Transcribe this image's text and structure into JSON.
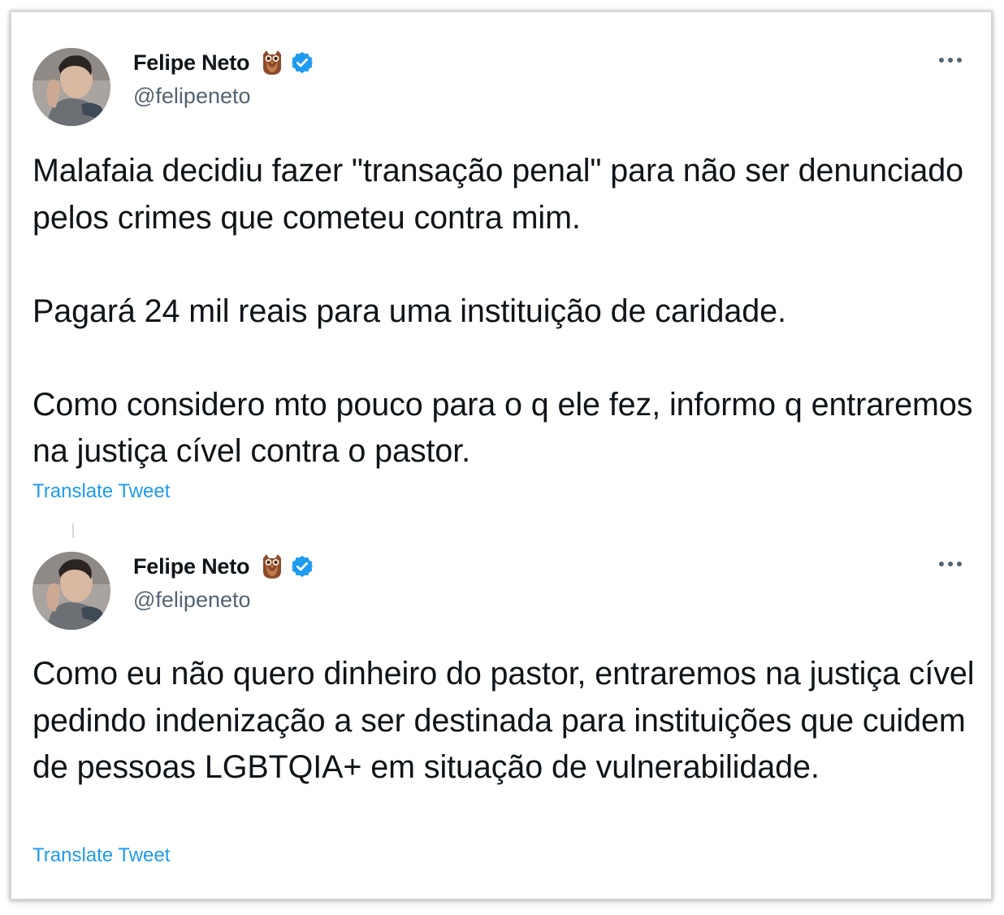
{
  "tweets": [
    {
      "author": {
        "name": "Felipe Neto",
        "handle": "@felipeneto",
        "emoji_icon": "owl-emoji-icon",
        "verified_icon": "verified-badge-icon"
      },
      "paragraphs": [
        "Malafaia decidiu fazer \"transação penal\" para não ser denunciado pelos crimes que cometeu contra mim.",
        "Pagará 24 mil reais para uma instituição de caridade.",
        "Como considero mto pouco para o q ele fez, informo q entraremos na justiça cível contra o pastor."
      ],
      "translate_label": "Translate Tweet",
      "more_icon": "more-options-icon"
    },
    {
      "author": {
        "name": "Felipe Neto",
        "handle": "@felipeneto",
        "emoji_icon": "owl-emoji-icon",
        "verified_icon": "verified-badge-icon"
      },
      "paragraphs": [
        "Como eu não quero dinheiro do pastor, entraremos na justiça cível pedindo indenização a ser destinada para instituições que cuidem de pessoas LGBTQIA+ em situação de vulnerabilidade."
      ],
      "translate_label": "Translate Tweet",
      "more_icon": "more-options-icon"
    }
  ],
  "colors": {
    "text_primary": "#0f1419",
    "text_secondary": "#536471",
    "link": "#1d9bf0",
    "verified": "#1d9bf0",
    "border": "#cfd9de"
  }
}
